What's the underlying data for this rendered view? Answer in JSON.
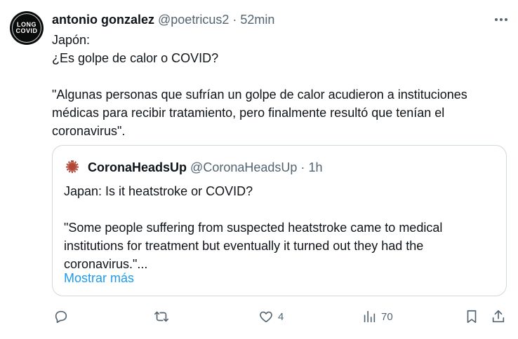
{
  "author": {
    "name": "antonio gonzalez",
    "handle": "@poetricus2",
    "separator": "·",
    "time": "52min",
    "avatar_text_1": "LONG",
    "avatar_text_2": "COVID"
  },
  "tweet": {
    "text": "Japón:\n¿Es golpe de calor o COVID?\n\n\"Algunas personas que sufrían un golpe de calor acudieron a instituciones médicas para recibir tratamiento, pero finalmente resultó que tenían el coronavirus\"."
  },
  "quoted": {
    "name": "CoronaHeadsUp",
    "handle": "@CoronaHeadsUp",
    "separator": "·",
    "time": "1h",
    "text": "Japan: Is it heatstroke or COVID?\n\n\"Some people suffering from suspected heatstroke came to medical institutions for treatment but eventually it turned out they had the coronavirus.\"...",
    "show_more": "Mostrar más"
  },
  "actions": {
    "replies": "",
    "retweets": "",
    "likes": "4",
    "views": "70"
  },
  "colors": {
    "text": "#0f1419",
    "secondary": "#536471",
    "link": "#1d9bf0",
    "border": "#cfd9de"
  },
  "icons": [
    "reply-icon",
    "retweet-icon",
    "like-icon",
    "views-icon",
    "bookmark-icon",
    "share-icon",
    "more-icon"
  ]
}
